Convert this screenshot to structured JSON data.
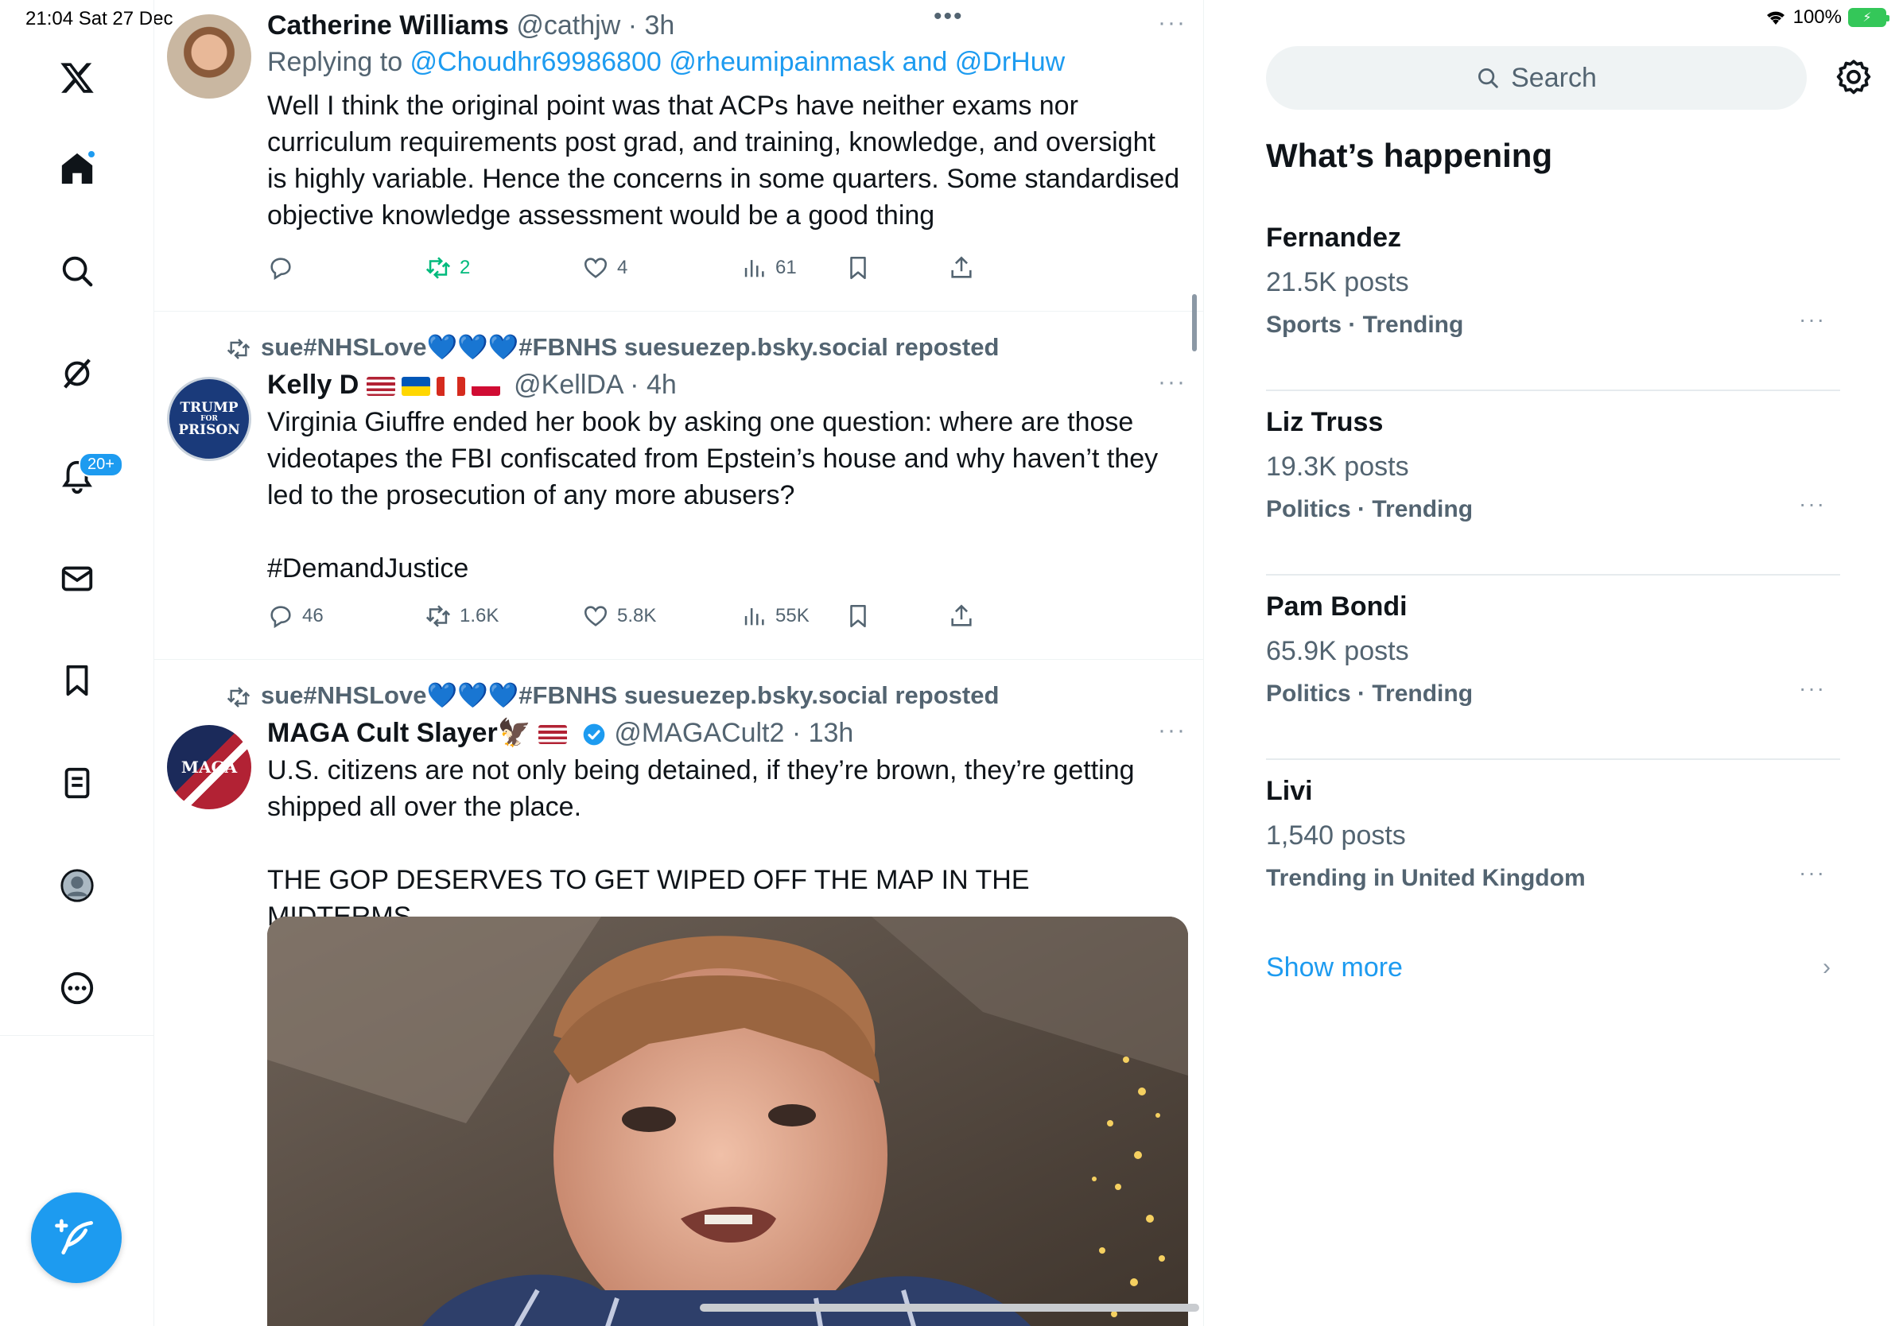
{
  "status_bar": {
    "time": "21:04  Sat 27 Dec",
    "battery_percent": "100%"
  },
  "nav": {
    "items": [
      {
        "name": "x-logo",
        "icon": "x-logo-icon"
      },
      {
        "name": "home",
        "icon": "home-icon"
      },
      {
        "name": "explore",
        "icon": "search-icon"
      },
      {
        "name": "grok",
        "icon": "grok-icon"
      },
      {
        "name": "notifications",
        "icon": "bell-icon",
        "badge": "20+"
      },
      {
        "name": "messages",
        "icon": "envelope-icon"
      },
      {
        "name": "bookmarks",
        "icon": "bookmark-icon"
      },
      {
        "name": "lists",
        "icon": "list-icon"
      },
      {
        "name": "profile",
        "icon": "profile-icon"
      },
      {
        "name": "more",
        "icon": "more-circle-icon"
      }
    ],
    "compose_icon": "compose-feather-icon"
  },
  "feed": {
    "top_menu": "•••",
    "tweets": [
      {
        "name": "Catherine Williams",
        "meta": "@cathjw · 3h",
        "more": "···",
        "reply_prefix": "Replying to ",
        "reply_handles": "@Choudhr69986800 @rheumipainmask and @DrHuw",
        "text": "Well I think the original point was that ACPs have neither exams nor curriculum requirements post grad, and training, knowledge, and oversight is highly variable. Hence the concerns in some quarters. Some standardised objective knowledge assessment would be a good thing",
        "actions": {
          "replies": "",
          "reposts": "2",
          "likes": "4",
          "views": "61"
        }
      },
      {
        "repost_by": "sue#NHSLove",
        "repost_hearts": "💙💙💙",
        "repost_rest": "#FBNHS suesuezep.bsky.social reposted",
        "name": "Kelly D",
        "meta": "@KellDA · 4h",
        "more": "···",
        "text_lines": [
          "Virginia Giuffre ended her book by asking one question: where are those videotapes the FBI confiscated from Epstein’s house and why haven’t they led to the prosecution of any more abusers?"
        ],
        "hashtag": "#DemandJustice",
        "avatar_text_1": "TRUMP",
        "avatar_text_2": "FOR",
        "avatar_text_3": "PRISON",
        "actions": {
          "replies": "46",
          "reposts": "1.6K",
          "likes": "5.8K",
          "views": "55K"
        }
      },
      {
        "repost_by": "sue#NHSLove",
        "repost_hearts": "💙💙💙",
        "repost_rest": "#FBNHS suesuezep.bsky.social reposted",
        "name": "MAGA Cult Slayer",
        "name_emoji": "🦅",
        "meta": "@MAGACult2 · 13h",
        "more": "···",
        "text_1": "U.S. citizens are not only being detained, if they’re brown, they’re getting shipped all over the place.",
        "text_2": "THE GOP DESERVES TO GET WIPED OFF THE MAP IN THE MIDTERMS.",
        "avatar_text": "MAGA"
      }
    ]
  },
  "sidebar": {
    "search_placeholder": "Search",
    "title": "What’s happening",
    "trends": [
      {
        "name": "Fernandez",
        "count": "21.5K posts",
        "category": "Sports · Trending"
      },
      {
        "name": "Liz Truss",
        "count": "19.3K posts",
        "category": "Politics · Trending"
      },
      {
        "name": "Pam Bondi",
        "count": "65.9K posts",
        "category": "Politics · Trending"
      },
      {
        "name": "Livi",
        "count": "1,540 posts",
        "category": "Trending in United Kingdom"
      }
    ],
    "more_label": "···",
    "show_more": "Show more",
    "chevron": "›"
  },
  "colors": {
    "accent": "#1d9bf0",
    "repost_green": "#00ba7c",
    "muted": "#536471"
  }
}
